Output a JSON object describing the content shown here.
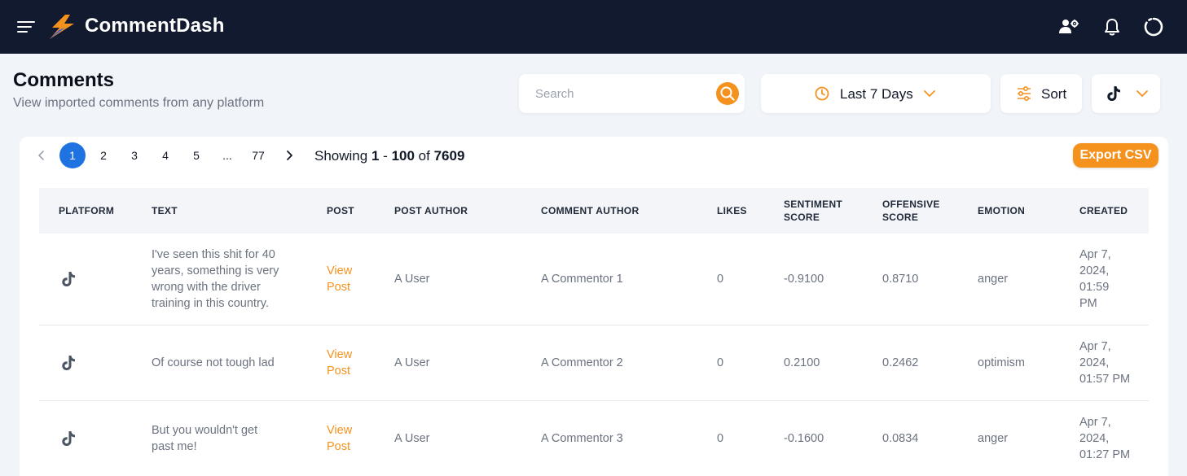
{
  "app": {
    "brand": "CommentDash"
  },
  "header": {
    "title": "Comments",
    "subtitle": "View imported comments from any platform"
  },
  "controls": {
    "search_placeholder": "Search",
    "date_range": "Last 7 Days",
    "sort_label": "Sort",
    "platform_icon": "tiktok-icon"
  },
  "pagination": {
    "pages": [
      "1",
      "2",
      "3",
      "4",
      "5",
      "...",
      "77"
    ],
    "current": "1",
    "showing_prefix": "Showing",
    "range_start": "1",
    "range_sep": "-",
    "range_end": "100",
    "of_label": "of",
    "total": "7609"
  },
  "export_label": "Export CSV",
  "table": {
    "columns": {
      "platform": "PLATFORM",
      "text": "TEXT",
      "post": "POST",
      "post_author": "POST AUTHOR",
      "comment_author": "COMMENT AUTHOR",
      "likes": "LIKES",
      "sentiment_line1": "SENTIMENT",
      "sentiment_line2": "SCORE",
      "offensive_line1": "OFFENSIVE",
      "offensive_line2": "SCORE",
      "emotion": "EMOTION",
      "created": "CREATED"
    },
    "rows": [
      {
        "platform": "tiktok-icon",
        "text_lines": [
          "I've seen this shit for 40",
          "years, something is very",
          "wrong with the driver",
          "training in this country."
        ],
        "post_lines": [
          "View",
          "Post"
        ],
        "post_author": "A User",
        "comment_author": "A Commentor 1",
        "likes": "0",
        "sentiment": "-0.9100",
        "offensive": "0.8710",
        "emotion": "anger",
        "created_lines": [
          "Apr 7,",
          "2024,",
          "01:59",
          "PM"
        ]
      },
      {
        "platform": "tiktok-icon",
        "text_lines": [
          "Of course not tough lad"
        ],
        "post_lines": [
          "View",
          "Post"
        ],
        "post_author": "A User",
        "comment_author": "A Commentor 2",
        "likes": "0",
        "sentiment": "0.2100",
        "offensive": "0.2462",
        "emotion": "optimism",
        "created_lines": [
          "Apr 7,",
          "2024,",
          "01:57 PM"
        ]
      },
      {
        "platform": "tiktok-icon",
        "text_lines": [
          "But you wouldn't get",
          "past me!"
        ],
        "post_lines": [
          "View",
          "Post"
        ],
        "post_author": "A User",
        "comment_author": "A Commentor 3",
        "likes": "0",
        "sentiment": "-0.1600",
        "offensive": "0.0834",
        "emotion": "anger",
        "created_lines": [
          "Apr 7,",
          "2024,",
          "01:27 PM"
        ]
      }
    ]
  },
  "colors": {
    "topbar": "#111a2e",
    "accent": "#f5921e",
    "active_page": "#1e73e0",
    "background": "#f1f4f8"
  }
}
